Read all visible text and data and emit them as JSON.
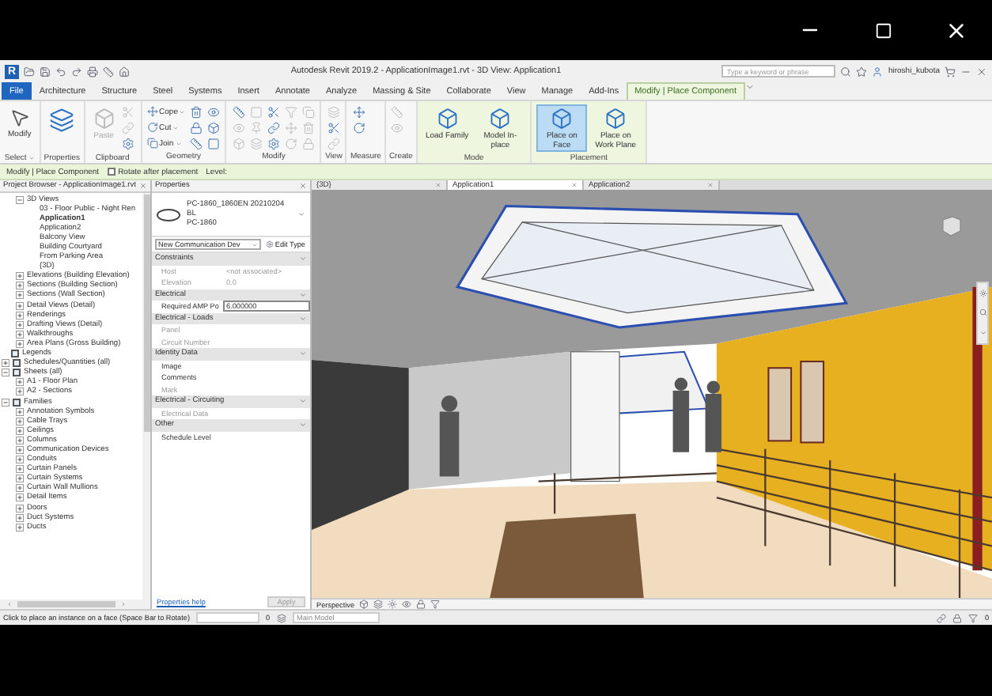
{
  "title_bar": {
    "app_logo": "R",
    "title": "Autodesk Revit 2019.2 - ApplicationImage1.rvt - 3D View: Application1",
    "search": {
      "placeholder": "Type a keyword or phrase"
    },
    "user": "hiroshi_kubota"
  },
  "ribbon_tabs": [
    {
      "label": "File",
      "kind": "file",
      "selected": false
    },
    {
      "label": "Architecture",
      "kind": "normal",
      "selected": false
    },
    {
      "label": "Structure",
      "kind": "normal",
      "selected": false
    },
    {
      "label": "Steel",
      "kind": "normal",
      "selected": false
    },
    {
      "label": "Systems",
      "kind": "normal",
      "selected": false
    },
    {
      "label": "Insert",
      "kind": "normal",
      "selected": false
    },
    {
      "label": "Annotate",
      "kind": "normal",
      "selected": false
    },
    {
      "label": "Analyze",
      "kind": "normal",
      "selected": false
    },
    {
      "label": "Massing & Site",
      "kind": "normal",
      "selected": false
    },
    {
      "label": "Collaborate",
      "kind": "normal",
      "selected": false
    },
    {
      "label": "View",
      "kind": "normal",
      "selected": false
    },
    {
      "label": "Manage",
      "kind": "normal",
      "selected": false
    },
    {
      "label": "Add-Ins",
      "kind": "normal",
      "selected": false
    },
    {
      "label": "Modify | Place Component",
      "kind": "contextual",
      "selected": true
    }
  ],
  "ribbon_panels": [
    {
      "label": "Select",
      "dropdown": true,
      "contextual": false,
      "buttons": [
        {
          "kind": "large",
          "label": "Modify",
          "disabled": false,
          "selected": false
        }
      ]
    },
    {
      "label": "Properties",
      "dropdown": false,
      "contextual": false,
      "buttons": [
        {
          "kind": "large",
          "disabled": false,
          "selected": false
        }
      ]
    },
    {
      "label": "Clipboard",
      "dropdown": false,
      "contextual": false,
      "buttons": [
        {
          "kind": "large",
          "label": "Paste",
          "disabled": true,
          "selected": false
        },
        {
          "kind": "icon",
          "disabled": true
        },
        {
          "kind": "icon",
          "disabled": true
        },
        {
          "kind": "icon",
          "disabled": false
        }
      ]
    },
    {
      "label": "Geometry",
      "dropdown": false,
      "contextual": false,
      "buttons": [
        {
          "kind": "small",
          "label": "Cope",
          "disabled": false
        },
        {
          "kind": "small",
          "label": "Cut",
          "disabled": false
        },
        {
          "kind": "small",
          "label": "Join",
          "disabled": false
        },
        {
          "kind": "icon",
          "disabled": false
        },
        {
          "kind": "icon",
          "disabled": false
        },
        {
          "kind": "icon",
          "disabled": false
        },
        {
          "kind": "icon",
          "disabled": false
        },
        {
          "kind": "icon",
          "disabled": false
        },
        {
          "kind": "icon",
          "disabled": false
        }
      ]
    },
    {
      "label": "Modify",
      "dropdown": false,
      "contextual": false,
      "buttons": [
        {
          "kind": "icon",
          "disabled": false
        },
        {
          "kind": "icon",
          "disabled": true
        },
        {
          "kind": "icon",
          "disabled": true
        },
        {
          "kind": "icon",
          "disabled": true
        },
        {
          "kind": "icon",
          "disabled": true
        },
        {
          "kind": "icon",
          "disabled": true
        },
        {
          "kind": "icon",
          "disabled": false
        },
        {
          "kind": "icon",
          "disabled": false
        },
        {
          "kind": "icon",
          "disabled": false
        },
        {
          "kind": "icon",
          "disabled": true
        },
        {
          "kind": "icon",
          "disabled": true
        },
        {
          "kind": "icon",
          "disabled": true
        },
        {
          "kind": "icon",
          "disabled": true
        },
        {
          "kind": "icon",
          "disabled": true
        },
        {
          "kind": "icon",
          "disabled": true
        }
      ]
    },
    {
      "label": "View",
      "dropdown": false,
      "contextual": false,
      "buttons": [
        {
          "kind": "icon",
          "disabled": true
        },
        {
          "kind": "icon",
          "disabled": false
        },
        {
          "kind": "icon",
          "disabled": true
        }
      ]
    },
    {
      "label": "Measure",
      "dropdown": false,
      "contextual": false,
      "buttons": [
        {
          "kind": "icon",
          "disabled": false
        },
        {
          "kind": "icon",
          "disabled": false
        }
      ]
    },
    {
      "label": "Create",
      "dropdown": false,
      "contextual": false,
      "buttons": [
        {
          "kind": "icon",
          "disabled": true
        },
        {
          "kind": "icon",
          "disabled": true
        }
      ]
    },
    {
      "label": "Mode",
      "dropdown": false,
      "contextual": true,
      "buttons": [
        {
          "kind": "large",
          "label": "Load Family",
          "disabled": false,
          "selected": false
        },
        {
          "kind": "large",
          "label": "Model In-place",
          "disabled": false,
          "selected": false
        }
      ]
    },
    {
      "label": "Placement",
      "dropdown": false,
      "contextual": true,
      "buttons": [
        {
          "kind": "large",
          "label": "Place on Face",
          "disabled": false,
          "selected": true
        },
        {
          "kind": "large",
          "label": "Place on Work Plane",
          "disabled": false,
          "selected": false
        }
      ]
    }
  ],
  "options_bar": {
    "context": "Modify | Place Component",
    "rotate_checkbox": {
      "label": "Rotate after placement",
      "checked": false
    },
    "level_label": "Level:"
  },
  "project_browser": {
    "title": "Project Browser - ApplicationImage1.rvt",
    "views_branch": [
      {
        "label": "3D Views",
        "expanded": true,
        "children": [
          {
            "label": "03 - Floor Public - Night Ren",
            "selected": false
          },
          {
            "label": "Application1",
            "selected": true
          },
          {
            "label": "Application2",
            "selected": false
          },
          {
            "label": "Balcony View",
            "selected": false
          },
          {
            "label": "Building Courtyard",
            "selected": false
          },
          {
            "label": "From Parking Area",
            "selected": false
          },
          {
            "label": "{3D}",
            "selected": false
          }
        ]
      },
      {
        "label": "Elevations (Building Elevation)",
        "expanded": false
      },
      {
        "label": "Sections (Building Section)",
        "expanded": false
      },
      {
        "label": "Sections (Wall Section)",
        "expanded": false
      },
      {
        "label": "Detail Views (Detail)",
        "expanded": false
      },
      {
        "label": "Renderings",
        "expanded": false
      },
      {
        "label": "Drafting Views (Detail)",
        "expanded": false
      },
      {
        "label": "Walkthroughs",
        "expanded": false
      },
      {
        "label": "Area Plans (Gross Building)",
        "expanded": false
      }
    ],
    "tree": [
      {
        "label": "Legends"
      },
      {
        "label": "Schedules/Quantities (all)",
        "expanded": false
      },
      {
        "label": "Sheets (all)",
        "expanded": true,
        "children": [
          {
            "label": "A1 - Floor Plan",
            "expanded": false
          },
          {
            "label": "A2 - Sections",
            "expanded": false
          }
        ]
      },
      {
        "label": "Families",
        "expanded": true,
        "children": [
          {
            "label": "Annotation Symbols",
            "expanded": false
          },
          {
            "label": "Cable Trays",
            "expanded": false
          },
          {
            "label": "Ceilings",
            "expanded": false
          },
          {
            "label": "Columns",
            "expanded": false
          },
          {
            "label": "Communication Devices",
            "expanded": false
          },
          {
            "label": "Conduits",
            "expanded": false
          },
          {
            "label": "Curtain Panels",
            "expanded": false
          },
          {
            "label": "Curtain Systems",
            "expanded": false
          },
          {
            "label": "Curtain Wall Mullions",
            "expanded": false
          },
          {
            "label": "Detail Items",
            "expanded": false
          },
          {
            "label": "Doors",
            "expanded": false
          },
          {
            "label": "Duct Systems",
            "expanded": false
          },
          {
            "label": "Ducts",
            "expanded": false
          }
        ]
      }
    ]
  },
  "properties": {
    "title": "Properties",
    "type_lines": [
      "PC-1860_1860EN 20210204",
      "BL",
      "PC-1860"
    ],
    "instance_filter": "New Communication Dev",
    "edit_type": "Edit Type",
    "groups": [
      {
        "name": "Constraints",
        "rows": [
          {
            "label": "Host",
            "value": "<not associated>",
            "disabled": true
          },
          {
            "label": "Elevation",
            "value": "0.0",
            "disabled": true
          }
        ]
      },
      {
        "name": "Electrical",
        "rows": [
          {
            "label": "Required AMP Po",
            "value": "6.000000",
            "disabled": false
          }
        ]
      },
      {
        "name": "Electrical - Loads",
        "rows": [
          {
            "label": "Panel",
            "disabled": true
          },
          {
            "label": "Circuit Number",
            "disabled": true
          }
        ]
      },
      {
        "name": "Identity Data",
        "rows": [
          {
            "label": "Image",
            "disabled": false
          },
          {
            "label": "Comments",
            "disabled": false
          },
          {
            "label": "Mark",
            "disabled": true
          }
        ]
      },
      {
        "name": "Electrical - Circuiting",
        "rows": [
          {
            "label": "Electrical Data",
            "disabled": true
          }
        ]
      },
      {
        "name": "Other",
        "rows": [
          {
            "label": "Schedule Level",
            "disabled": false
          }
        ]
      }
    ],
    "help_link": "Properties help",
    "apply": {
      "label": "Apply",
      "disabled": true
    }
  },
  "view_tabs": [
    {
      "label": "{3D}",
      "selected": false
    },
    {
      "label": "Application1",
      "selected": true
    },
    {
      "label": "Application2",
      "selected": false
    }
  ],
  "view_bar": {
    "mode": "Perspective"
  },
  "status_bar": {
    "message": "Click to place an instance on a face (Space Bar to Rotate)",
    "design_option_count": "0",
    "workset": "Main Model",
    "filter_count": "0"
  }
}
